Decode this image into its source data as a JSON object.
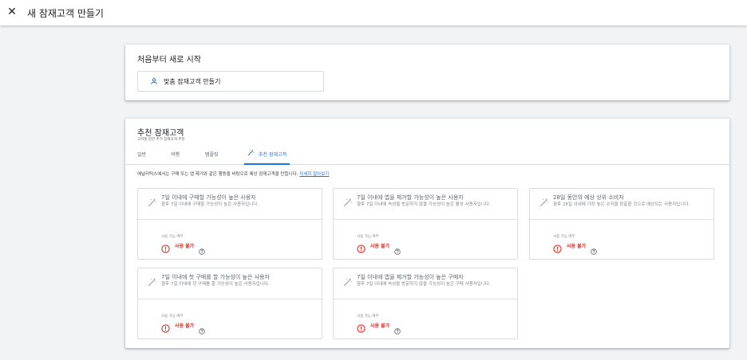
{
  "topbar": {
    "close_icon": "close-icon",
    "title": "새 잠재고객 만들기"
  },
  "scratch": {
    "heading": "처음부터 새로 시작",
    "custom_button_icon": "person-icon",
    "custom_button_label": "맞춤 잠재고객 만들기"
  },
  "suggested": {
    "heading": "추천 잠재고객",
    "subheading": "고려할 만한 추가 잠재고객 추천",
    "tabs": [
      {
        "label": "일반"
      },
      {
        "label": "여행"
      },
      {
        "label": "템플릿"
      },
      {
        "label": "추천 잠재고객",
        "icon": "magic-wand-icon"
      }
    ],
    "description": "애널리틱스에서는 구매 또는 앱 제거와 같은 행동을 바탕으로 예상 잠재고객을 만듭니다.",
    "learn_more": "자세히 알아보기",
    "tiles": [
      {
        "title": "7일 이내에 구매할 가능성이 높은 사용자",
        "desc": "향후 7일 이내에 구매할 가능성이 높은 사용자입니다.",
        "avail_label": "사용 가능 여부",
        "status": "사용 불가"
      },
      {
        "title": "7일 이내에 앱을 제거할 가능성이 높은 사용자",
        "desc": "향후 7일 이내에 속성을 방문하지 않을 가능성이 높은 활성 사용자입니다.",
        "avail_label": "사용 가능 여부",
        "status": "사용 불가"
      },
      {
        "title": "28일 동안의 예상 상위 소비자",
        "desc": "향후 28일 이내에 가장 높은 수익을 창출할 것으로 예상되는 사용자입니다.",
        "avail_label": "사용 가능 여부",
        "status": "사용 불가"
      },
      {
        "title": "7일 이내에 첫 구매를 할 가능성이 높은 사용자",
        "desc": "향후 7일 이내에 첫 구매를 할 가능성이 높은 사용자입니다.",
        "avail_label": "사용 가능 여부",
        "status": "사용 불가"
      },
      {
        "title": "7일 이내에 앱을 제거할 가능성이 높은 구매자",
        "desc": "향후 7일 이내에 속성을 방문하지 않을 가능성이 높은 구매 사용자입니다.",
        "avail_label": "사용 가능 여부",
        "status": "사용 불가"
      }
    ]
  },
  "colors": {
    "accent": "#1a73e8",
    "error": "#d93025",
    "background": "#f1f3f4"
  }
}
